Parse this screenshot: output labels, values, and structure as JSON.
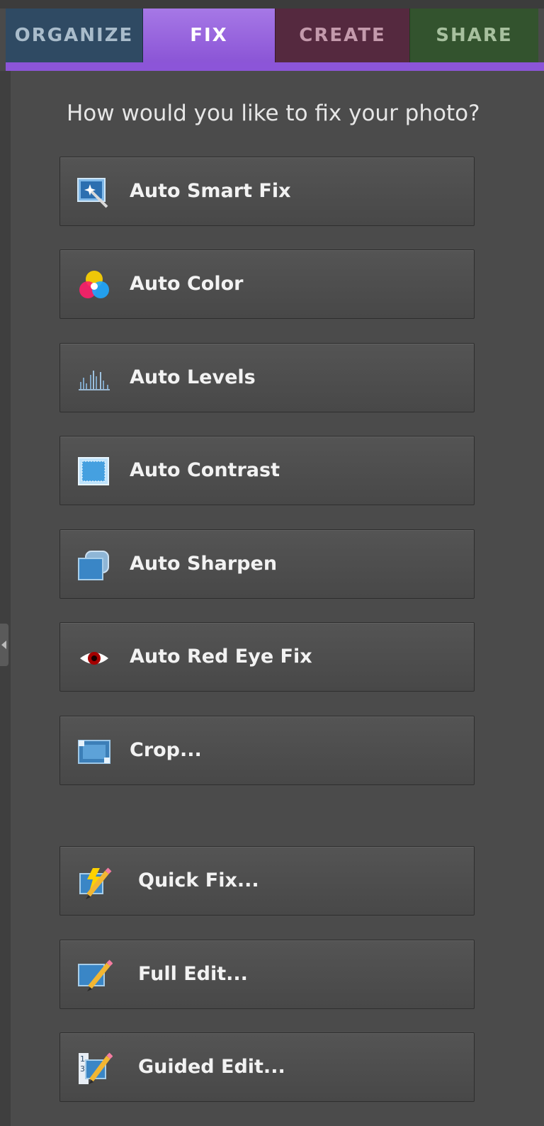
{
  "tabs": [
    {
      "label": "ORGANIZE",
      "color": "#2f4a63"
    },
    {
      "label": "FIX",
      "color": "#9565dc",
      "active": true
    },
    {
      "label": "CREATE",
      "color": "#55293f"
    },
    {
      "label": "SHARE",
      "color": "#33532e"
    }
  ],
  "prompt": "How would you like to fix your photo?",
  "buttons": [
    {
      "label": "Auto Smart Fix",
      "icon": "auto-smart-fix-icon"
    },
    {
      "label": "Auto Color",
      "icon": "color-wheel-icon"
    },
    {
      "label": "Auto Levels",
      "icon": "histogram-icon"
    },
    {
      "label": "Auto Contrast",
      "icon": "contrast-icon"
    },
    {
      "label": "Auto Sharpen",
      "icon": "sharpen-icon"
    },
    {
      "label": "Auto Red Eye Fix",
      "icon": "red-eye-icon"
    },
    {
      "label": "Crop...",
      "icon": "crop-icon"
    },
    {
      "label": "Quick Fix...",
      "icon": "quick-fix-icon"
    },
    {
      "label": "Full Edit...",
      "icon": "full-edit-icon"
    },
    {
      "label": "Guided Edit...",
      "icon": "guided-edit-icon"
    }
  ]
}
